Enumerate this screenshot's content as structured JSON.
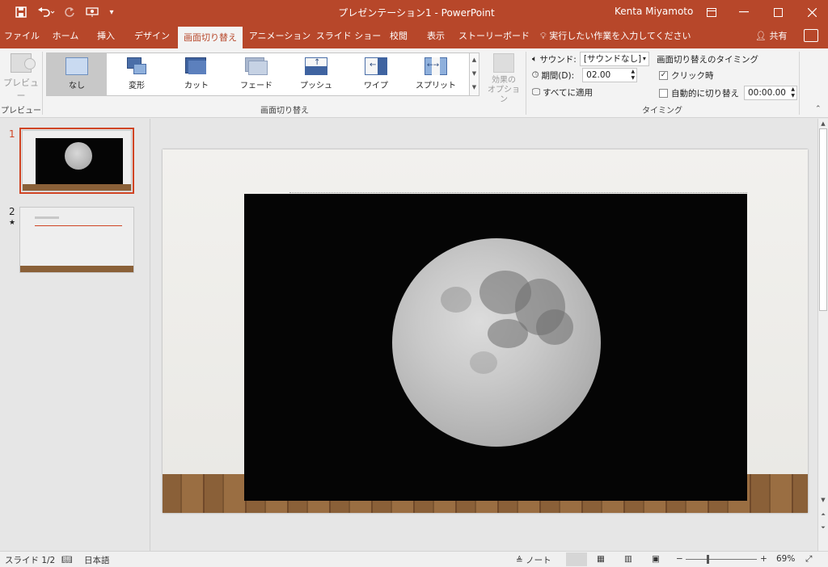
{
  "titlebar": {
    "title": "プレゼンテーション1 - PowerPoint",
    "user": "Kenta Miyamoto",
    "save_icon": "save-icon",
    "undo_icon": "undo-icon",
    "redo_icon": "redo-icon",
    "present_icon": "present-from-start-icon"
  },
  "tabs": [
    {
      "label": "ファイル"
    },
    {
      "label": "ホーム"
    },
    {
      "label": "挿入"
    },
    {
      "label": "デザイン"
    },
    {
      "label": "画面切り替え"
    },
    {
      "label": "アニメーション"
    },
    {
      "label": "スライド ショー"
    },
    {
      "label": "校閲"
    },
    {
      "label": "表示"
    },
    {
      "label": "ストーリーボード"
    }
  ],
  "tellme": "実行したい作業を入力してください",
  "share": "共有",
  "ribbon": {
    "preview_label": "プレビュー",
    "preview_group": "プレビュー",
    "transitions_group": "画面切り替え",
    "timing_group": "タイミング",
    "gallery": [
      {
        "label": "なし",
        "icon": "none-transition-icon"
      },
      {
        "label": "変形",
        "icon": "morph-transition-icon"
      },
      {
        "label": "カット",
        "icon": "cut-transition-icon"
      },
      {
        "label": "フェード",
        "icon": "fade-transition-icon"
      },
      {
        "label": "プッシュ",
        "icon": "push-transition-icon"
      },
      {
        "label": "ワイプ",
        "icon": "wipe-transition-icon"
      },
      {
        "label": "スプリット",
        "icon": "split-transition-icon"
      }
    ],
    "effect_options_line1": "効果の",
    "effect_options_line2": "オプション",
    "sound_label": "サウンド:",
    "sound_value": "[サウンドなし]",
    "duration_label": "期間(D):",
    "duration_value": "02.00",
    "apply_all": "すべてに適用",
    "advance_title": "画面切り替えのタイミング",
    "on_click_label": "クリック時",
    "on_click_checked": true,
    "after_label": "自動的に切り替え",
    "after_checked": false,
    "after_value": "00:00.00"
  },
  "slides": [
    {
      "number": "1"
    },
    {
      "number": "2",
      "marker": "★"
    }
  ],
  "statusbar": {
    "slide_info": "スライド 1/2",
    "language": "日本語",
    "notes": "ノート",
    "zoom": "69%"
  }
}
